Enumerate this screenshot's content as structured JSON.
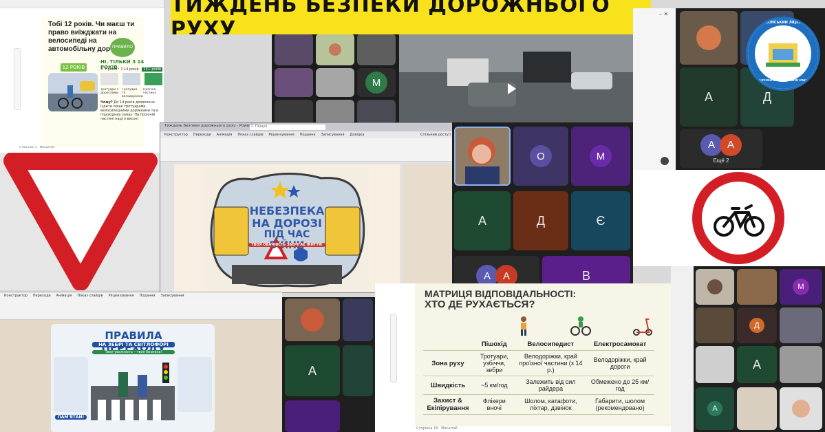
{
  "banner": {
    "title": "ТИЖДЕНЬ БЕЗПЕКИ ДОРОЖНЬОГО РУХУ",
    "bg": "#f7e21b"
  },
  "slide1": {
    "question": "Тобі 12 років. Чи маєш ти право виїжджати на велосипеді на автомобільну дорогу?",
    "age_badge": "12 РОКІВ",
    "rule_badge": "ПРАВИЛО",
    "answer": "НІ. ТІЛЬКИ З 14 РОКІВ.",
    "col1_head": "< 7 років",
    "col1_body": "Тротуари з дорослими",
    "col2_head": "7-14 років",
    "col2_body": "Тротуари та велодоріжки",
    "col3_head": "14+ років",
    "col3_body": "Проїзна частина",
    "why_label": "Чому?",
    "why_text": "До 14 років дозволено їздити лише тротуарами, велосипедними доріжками та в пішохідних зонах. На проїзній частині надто високі",
    "footer": "Сторінка 3 · Масштаб"
  },
  "crest": {
    "line1": "ХЕРСОНСЬКИЙ ЛІЦЕЙ №5",
    "line2": "ХЕРСОНСЬКОЇ МІСЬКОЇ РАДИ"
  },
  "ppt": {
    "title_bar": "Тиждень безпеки дорожнього руху - PowerPoint",
    "search": "Пошук",
    "tabs": [
      "Конструктор",
      "Переходи",
      "Анімація",
      "Показ слайдів",
      "Рецензування",
      "Подання",
      "Записування",
      "Довідка"
    ],
    "share": "Спільний доступ",
    "poster_line1": "НЕБЕЗПЕКА",
    "poster_line2": "НА ДОРОЗІ",
    "poster_line3": "ПІД ЧАС ВІЙНИ",
    "poster_sub": "ТВОЯ ОБАЧНІСТЬ ЗБЕРІГАЄ ЖИТТЯ!"
  },
  "ppt2": {
    "tabs": [
      "Конструктор",
      "Переходи",
      "Анімація",
      "Показ слайдів",
      "Рецензування",
      "Подання",
      "Записування"
    ],
    "poster_title": "ПРАВИЛА ПЕРЕХОДУ",
    "poster_sub": "НА ЗЕБРІ ТА СВІТЛОФОРІ",
    "poster_tag": "Твоя уважність – твоя безпека!",
    "poster_footer": "ПАМ'ЯТАЙ!"
  },
  "meet_main": {
    "tiles": [
      {
        "letter": "О",
        "bg": "#5b3a9e"
      },
      {
        "letter": "М",
        "bg": "#6a2ba8"
      },
      {
        "letter": "А",
        "bg": "#1f5a3a"
      },
      {
        "letter": "Д",
        "bg": "#8a3a1a"
      },
      {
        "letter": "Є",
        "bg": "#1f5e7a"
      },
      {
        "letter": "В",
        "bg": "#7a2ca8"
      }
    ],
    "pair_a": "А",
    "pair_a2": "А"
  },
  "meet_top_right": {
    "big_a": "А",
    "big_d": "Д",
    "pair_a": "А",
    "pair_a2": "А",
    "more": "Ещё 2"
  },
  "meet_top_center": {
    "m": "М"
  },
  "meet_bottom_center": {
    "a": "А"
  },
  "meet_bottom_right": {
    "m": "М",
    "d": "Д",
    "a": "А",
    "a2": "А"
  },
  "table_slide": {
    "title_line1": "МАТРИЦЯ ВІДПОВІДАЛЬНОСТІ:",
    "title_line2": "ХТО ДЕ РУХАЄТЬСЯ?",
    "headers": [
      "Пішохід",
      "Велосипедист",
      "Електросамокат"
    ],
    "rows": [
      {
        "label": "Зона руху",
        "cells": [
          "Тротуари, узбіччя, зебри",
          "Велодоріжки, край проїзної частини (з 14 р.)",
          "Велодоріжки, край дороги"
        ]
      },
      {
        "label": "Швидкість",
        "cells": [
          "~5 км/год",
          "Залежить від сил райдера",
          "Обмежено до 25 км/год"
        ]
      },
      {
        "label": "Захист & Екіпірування",
        "cells": [
          "Флікери вночі",
          "Шолом, катафоти, ліхтар, дзвінок",
          "Габарити, шолом (рекомендовано)"
        ]
      }
    ],
    "footer": "Сторінка 18 · Масштаб"
  },
  "colors": {
    "red": "#d6202a",
    "dark": "#1f1f1f",
    "tile_dark": "#2b2b2b"
  }
}
